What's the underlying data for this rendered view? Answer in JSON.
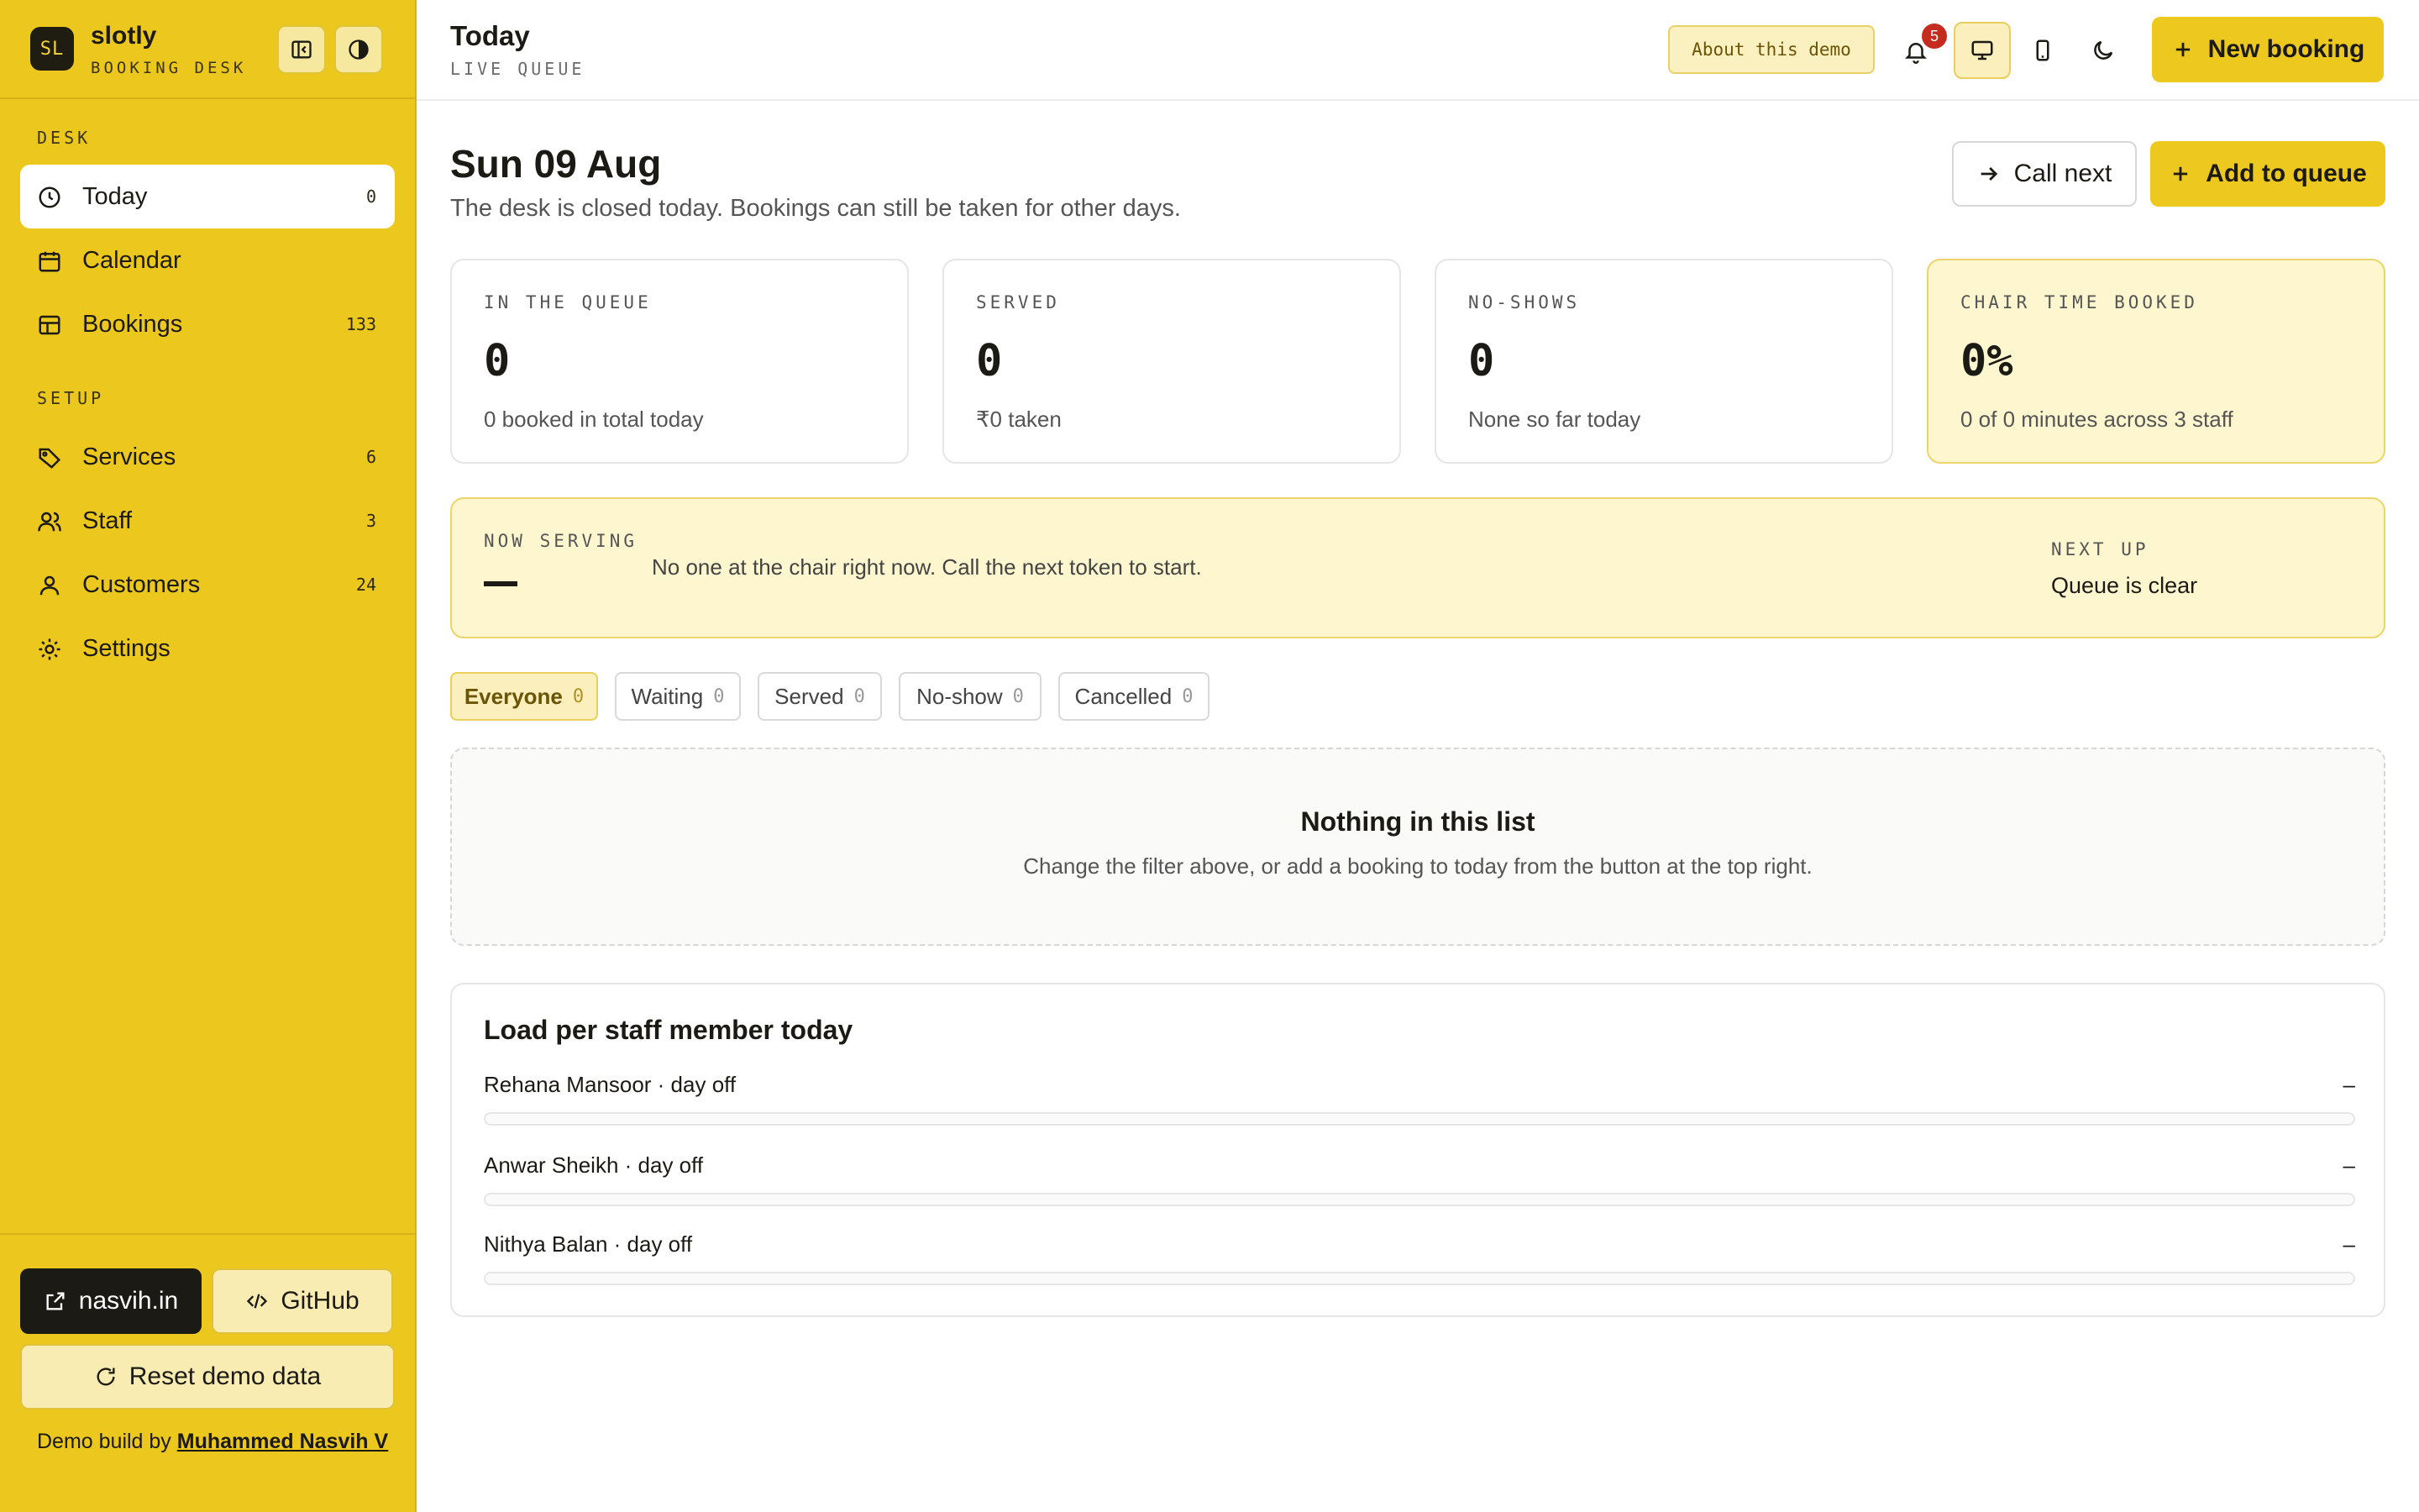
{
  "brand": {
    "logo": "SL",
    "name": "slotly",
    "subtitle": "BOOKING DESK"
  },
  "sidebar": {
    "sections": [
      {
        "label": "DESK",
        "items": [
          {
            "label": "Today",
            "count": "0",
            "icon": "clock-icon",
            "active": true
          },
          {
            "label": "Calendar",
            "count": "",
            "icon": "calendar-icon"
          },
          {
            "label": "Bookings",
            "count": "133",
            "icon": "table-icon"
          }
        ]
      },
      {
        "label": "SETUP",
        "items": [
          {
            "label": "Services",
            "count": "6",
            "icon": "tag-icon"
          },
          {
            "label": "Staff",
            "count": "3",
            "icon": "users-icon"
          },
          {
            "label": "Customers",
            "count": "24",
            "icon": "user-icon"
          },
          {
            "label": "Settings",
            "count": "",
            "icon": "gear-icon"
          }
        ]
      }
    ],
    "footer": {
      "site_label": "nasvih.in",
      "github_label": "GitHub",
      "reset_label": "Reset demo data",
      "credit_prefix": "Demo build by ",
      "credit_name": "Muhammed Nasvih V"
    }
  },
  "header": {
    "title": "Today",
    "subtitle": "LIVE QUEUE",
    "about_label": "About this demo",
    "notification_count": "5",
    "new_booking_label": "New booking"
  },
  "main": {
    "date": "Sun 09 Aug",
    "notice": "The desk is closed today. Bookings can still be taken for other days.",
    "call_next_label": "Call next",
    "add_queue_label": "Add to queue",
    "stats": [
      {
        "label": "IN THE QUEUE",
        "value": "0",
        "desc": "0 booked in total today"
      },
      {
        "label": "SERVED",
        "value": "0",
        "desc": "₹0 taken"
      },
      {
        "label": "NO-SHOWS",
        "value": "0",
        "desc": "None so far today"
      },
      {
        "label": "CHAIR TIME BOOKED",
        "value": "0%",
        "desc": "0 of 0 minutes across 3 staff"
      }
    ],
    "serving": {
      "label": "NOW SERVING",
      "message": "No one at the chair right now. Call the next token to start.",
      "next_label": "NEXT UP",
      "next_value": "Queue is clear"
    },
    "filters": [
      {
        "label": "Everyone",
        "count": "0",
        "active": true
      },
      {
        "label": "Waiting",
        "count": "0"
      },
      {
        "label": "Served",
        "count": "0"
      },
      {
        "label": "No-show",
        "count": "0"
      },
      {
        "label": "Cancelled",
        "count": "0"
      }
    ],
    "empty": {
      "title": "Nothing in this list",
      "desc": "Change the filter above, or add a booking to today from the button at the top right."
    },
    "load": {
      "title": "Load per staff member today",
      "staff": [
        {
          "name": "Rehana Mansoor · day off",
          "value": "–",
          "load": 0
        },
        {
          "name": "Anwar Sheikh · day off",
          "value": "–",
          "load": 0
        },
        {
          "name": "Nithya Balan · day off",
          "value": "–",
          "load": 0
        }
      ]
    }
  },
  "colors": {
    "accent": "#edc91f",
    "sidebar": "#ecc71d",
    "highlight": "#fdf6cf",
    "badge": "#c62b1f"
  }
}
